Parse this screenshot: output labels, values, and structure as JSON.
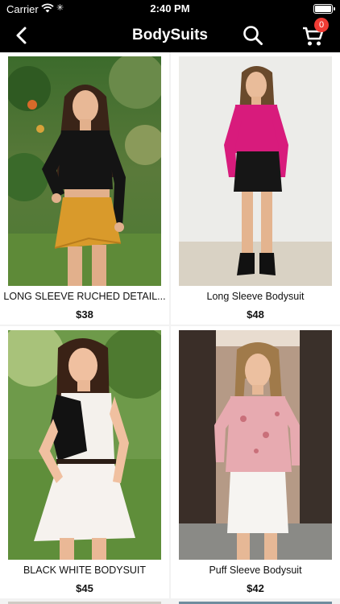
{
  "status_bar": {
    "carrier": "Carrier",
    "time": "2:40 PM"
  },
  "nav": {
    "title": "BodySuits",
    "cart_count": "0"
  },
  "products": [
    {
      "name": "LONG SLEEVE RUCHED DETAIL...",
      "price": "$38"
    },
    {
      "name": "Long Sleeve Bodysuit",
      "price": "$48"
    },
    {
      "name": "BLACK WHITE BODYSUIT",
      "price": "$45"
    },
    {
      "name": "Puff Sleeve Bodysuit",
      "price": "$42"
    }
  ],
  "colors": {
    "bar": "#000000",
    "badge": "#f03b34",
    "magenta_top": "#d81b7c",
    "mustard_skirt": "#d99a2b"
  },
  "icons": [
    "back-arrow-icon",
    "search-icon",
    "cart-icon"
  ]
}
